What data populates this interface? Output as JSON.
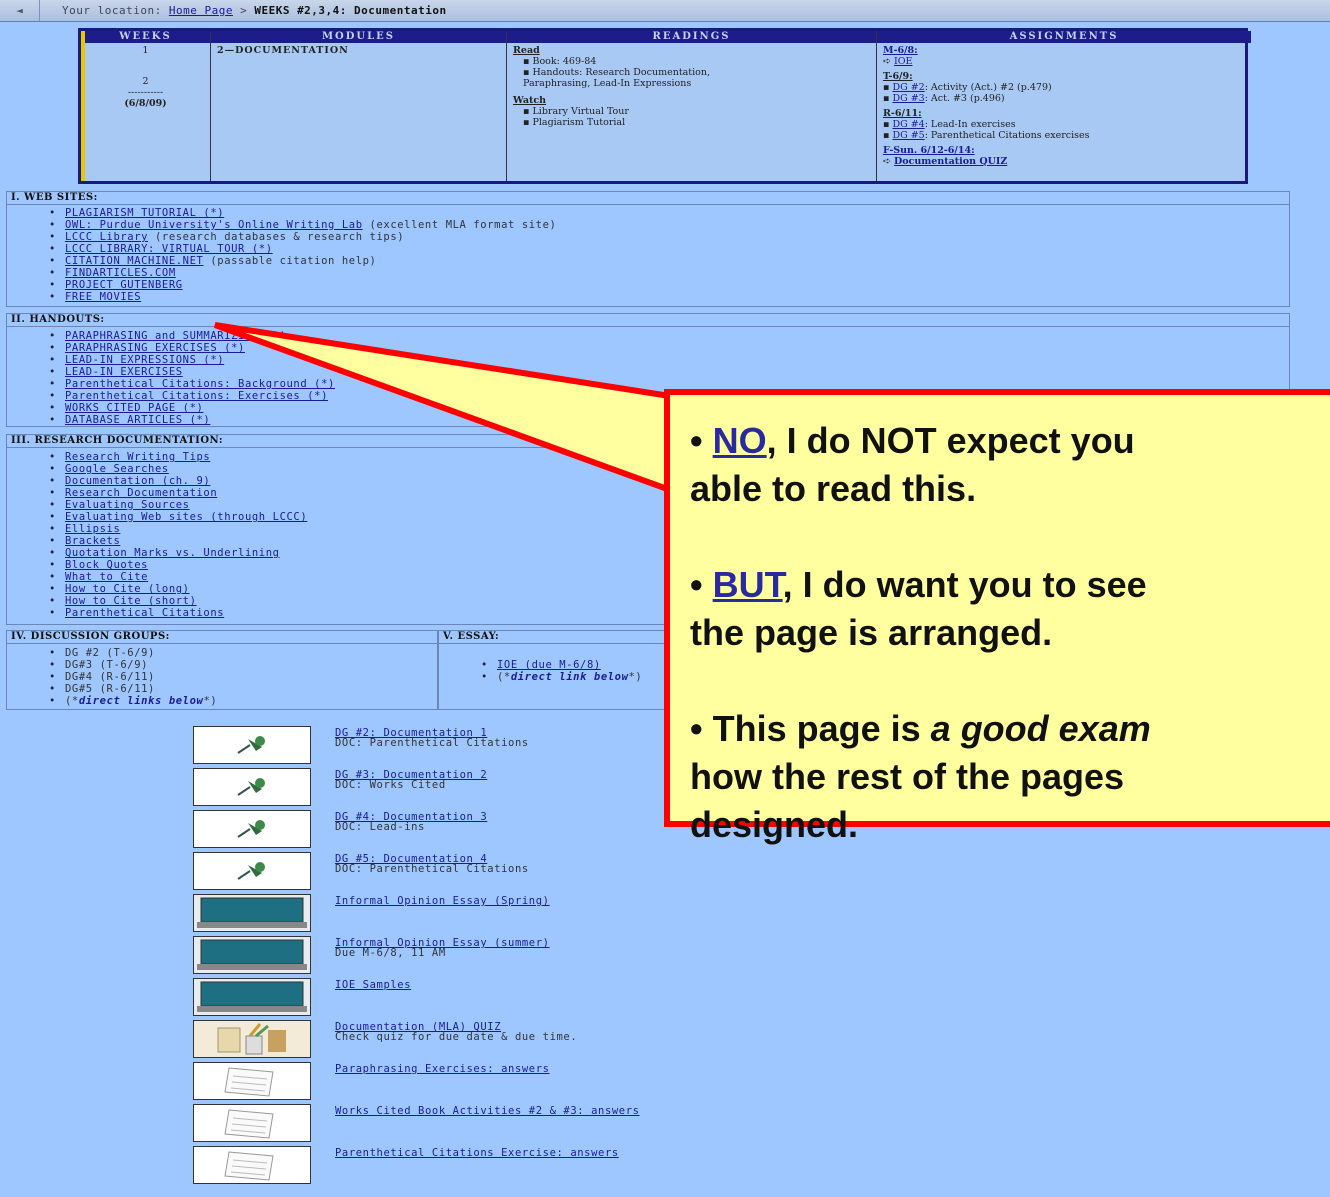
{
  "breadcrumb": {
    "back": "◄",
    "prefix": "Your location:",
    "home": "Home Page",
    "separator": ">",
    "current": "WEEKS #2,3,4: Documentation"
  },
  "schedule": {
    "headers": [
      "WEEKS",
      "MODULES",
      "READINGS",
      "ASSIGNMENTS"
    ],
    "week_num": "1",
    "week_2": "2",
    "week_divider": "-----------",
    "week_date": "(6/8/09)",
    "module": "2—DOCUMENTATION",
    "read_label": "Read",
    "read_items": [
      "Book: 469-84",
      "Handouts: Research Documentation, Paraphrasing, Lead-In Expressions"
    ],
    "watch_label": "Watch",
    "watch_items": [
      "Library Virtual Tour",
      "Plagiarism Tutorial"
    ],
    "assign": {
      "m": "M-6/8:",
      "m_item": "IOE",
      "t": "T-6/9:",
      "t_items": [
        {
          "link": "DG #2",
          "text": ": Activity (Act.) #2 (p.479)"
        },
        {
          "link": "DG #3",
          "text": ": Act. #3 (p.496)"
        }
      ],
      "r": "R-6/11:",
      "r_items": [
        {
          "link": "DG #4",
          "text": ": Lead-In exercises"
        },
        {
          "link": "DG #5",
          "text": ": Parenthetical Citations exercises"
        }
      ],
      "f": "F-Sun. 6/12-6/14:",
      "f_item": "Documentation QUIZ"
    }
  },
  "web_sites": {
    "title": "I. WEB SITES:",
    "items": [
      {
        "link": "PLAGIARISM TUTORIAL (*)",
        "desc": ""
      },
      {
        "link": "OWL: Purdue University's Online Writing Lab",
        "desc": " (excellent MLA format site)"
      },
      {
        "link": "LCCC Library",
        "desc": " (research databases & research tips)"
      },
      {
        "link": "LCCC LIBRARY: VIRTUAL TOUR (*)",
        "desc": ""
      },
      {
        "link": "CITATION MACHINE.NET",
        "desc": " (passable citation help)"
      },
      {
        "link": "FINDARTICLES.COM",
        "desc": ""
      },
      {
        "link": "PROJECT GUTENBERG",
        "desc": ""
      },
      {
        "link": "FREE MOVIES",
        "desc": ""
      }
    ]
  },
  "handouts": {
    "title": "II. HANDOUTS:",
    "items": [
      "PARAPHRASING and SUMMARIZING (*)",
      "PARAPHRASING EXERCISES (*)",
      "LEAD-IN EXPRESSIONS (*)",
      "LEAD-IN EXERCISES",
      "Parenthetical Citations: Background (*)",
      "Parenthetical Citations: Exercises (*)",
      "WORKS CITED PAGE (*)",
      "DATABASE ARTICLES (*)"
    ]
  },
  "research": {
    "title": "III. RESEARCH DOCUMENTATION:",
    "items": [
      "Research Writing Tips",
      "Google Searches",
      "Documentation (ch. 9)",
      "Research Documentation",
      "Evaluating Sources",
      "Evaluating Web sites (through LCCC)",
      "Ellipsis",
      "Brackets",
      "Quotation Marks vs. Underlining",
      "Block Quotes",
      "What to Cite",
      "How to Cite (long)",
      "How to Cite (short)",
      "Parenthetical Citations"
    ]
  },
  "discussion": {
    "title": "IV. DISCUSSION GROUPS:",
    "items": [
      "DG #2 (T-6/9)",
      "DG#3 (T-6/9)",
      "DG#4 (R-6/11)",
      "DG#5 (R-6/11)"
    ],
    "note_open": "(*",
    "note_link": "direct links below",
    "note_close": "*)"
  },
  "essay": {
    "title": "V. ESSAY:",
    "item": "IOE (due M-6/8)",
    "note_open": "(*",
    "note_link": "direct link below",
    "note_close": "*)"
  },
  "icon_links": [
    {
      "icon": "pushpin-icon",
      "link": "DG #2: Documentation 1",
      "sub": "DOC: Parenthetical Citations"
    },
    {
      "icon": "pushpin-icon",
      "link": "DG #3: Documentation 2",
      "sub": "DOC: Works Cited"
    },
    {
      "icon": "pushpin-icon",
      "link": "DG #4: Documentation 3",
      "sub": "DOC: Lead-ins"
    },
    {
      "icon": "pushpin-icon",
      "link": "DG #5: Documentation 4",
      "sub": "DOC: Parenthetical Citations"
    },
    {
      "icon": "laptop-icon",
      "link": "Informal Opinion Essay (Spring)",
      "sub": ""
    },
    {
      "icon": "laptop-icon",
      "link": "Informal Opinion Essay (summer)",
      "sub": "Due M-6/8, 11 AM"
    },
    {
      "icon": "laptop-icon",
      "link": "IOE Samples",
      "sub": ""
    },
    {
      "icon": "pencils-cup-icon",
      "link": "Documentation (MLA) QUIZ",
      "sub": "Check quiz for due date & due time."
    },
    {
      "icon": "notepaper-icon",
      "link": "Paraphrasing Exercises: answers",
      "sub": ""
    },
    {
      "icon": "notepaper-icon",
      "link": "Works Cited Book Activities #2 & #3: answers",
      "sub": ""
    },
    {
      "icon": "notepaper-icon",
      "link": "Parenthetical Citations Exercise: answers",
      "sub": ""
    }
  ],
  "callout": {
    "p1_bullet": "•",
    "p1_no": "NO",
    "p1_rest_a": ", I do NOT expect you",
    "p1_rest_b": "able to read this.",
    "p2_bullet": "•",
    "p2_but": "BUT",
    "p2_rest_a": ", I do want you to see",
    "p2_rest_b": "the page is arranged.",
    "p3_a": "• This page is ",
    "p3_em": "a good exam",
    "p3_b": "how the rest of the pages",
    "p3_c": "designed.",
    "colors": {
      "fill": "#ffffa0",
      "border": "#ff0000"
    }
  }
}
